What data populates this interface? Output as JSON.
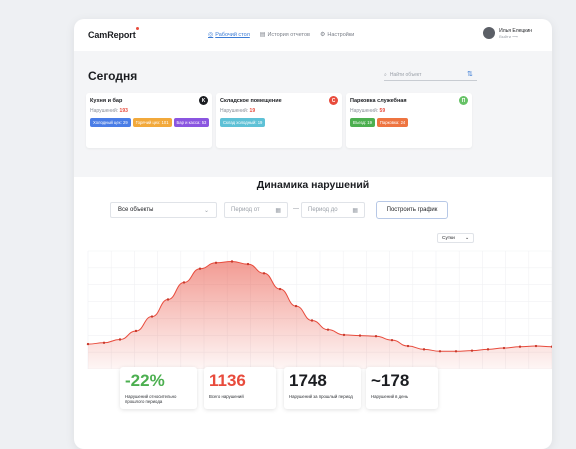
{
  "header": {
    "logo": "CamReport",
    "nav": [
      {
        "icon": "dashboard-icon",
        "label": "Рабочий стол",
        "active": true
      },
      {
        "icon": "calendar-icon",
        "label": "История отчетов",
        "active": false
      },
      {
        "icon": "gear-icon",
        "label": "Настройки",
        "active": false
      }
    ],
    "user": {
      "name": "Илья Елецкин",
      "sub": "Выйти ⟶"
    }
  },
  "today": {
    "title": "Сегодня",
    "search_placeholder": "Найти объект",
    "locations": [
      {
        "name": "Кухня и бар",
        "count_label": "Нарушений:",
        "count": "193",
        "badge": "K",
        "badge_color": "#1b1d21",
        "tags": [
          {
            "label": "Холодный цех: 29",
            "color": "#4a7de6"
          },
          {
            "label": "Горячий цех: 101",
            "color": "#f2a93b"
          },
          {
            "label": "Бар и касса: 53",
            "color": "#8a55e0"
          }
        ]
      },
      {
        "name": "Складское помещение",
        "count_label": "Нарушений:",
        "count": "19",
        "badge": "C",
        "badge_color": "#e84b3c",
        "tags": [
          {
            "label": "Склад холодный: 19",
            "color": "#5ec1d6"
          }
        ]
      },
      {
        "name": "Парковка служебная",
        "count_label": "Нарушений:",
        "count": "59",
        "badge": "П",
        "badge_color": "#66c266",
        "tags": [
          {
            "label": "Въезд: 19",
            "color": "#4caf50"
          },
          {
            "label": "Парковка: 24",
            "color": "#ee7440"
          }
        ]
      }
    ]
  },
  "dynamics": {
    "title": "Динамика нарушений",
    "object_select": "Все объекты",
    "date_from_placeholder": "Период от",
    "date_to_placeholder": "Период до",
    "dash": "—",
    "build_button": "Построить график",
    "period_select": "Сутки"
  },
  "chart_data": {
    "type": "area",
    "series": [
      {
        "values": [
          38,
          40,
          45,
          58,
          80,
          106,
          132,
          153,
          162,
          164,
          160,
          146,
          122,
          96,
          74,
          60,
          52,
          51,
          50,
          44,
          35,
          30,
          27,
          27,
          28,
          30,
          32,
          34,
          35,
          34
        ]
      }
    ],
    "color": "#e84b3c"
  },
  "stats": [
    {
      "value": "-22%",
      "label": "Нарушений относительно прошлого периода",
      "color": "#4caf50"
    },
    {
      "value": "1136",
      "label": "Всего нарушений",
      "color": "#e84b3c"
    },
    {
      "value": "1748",
      "label": "Нарушений за прошлый период",
      "color": "#1b1d21"
    },
    {
      "value": "~178",
      "label": "Нарушений в день",
      "color": "#1b1d21"
    }
  ]
}
